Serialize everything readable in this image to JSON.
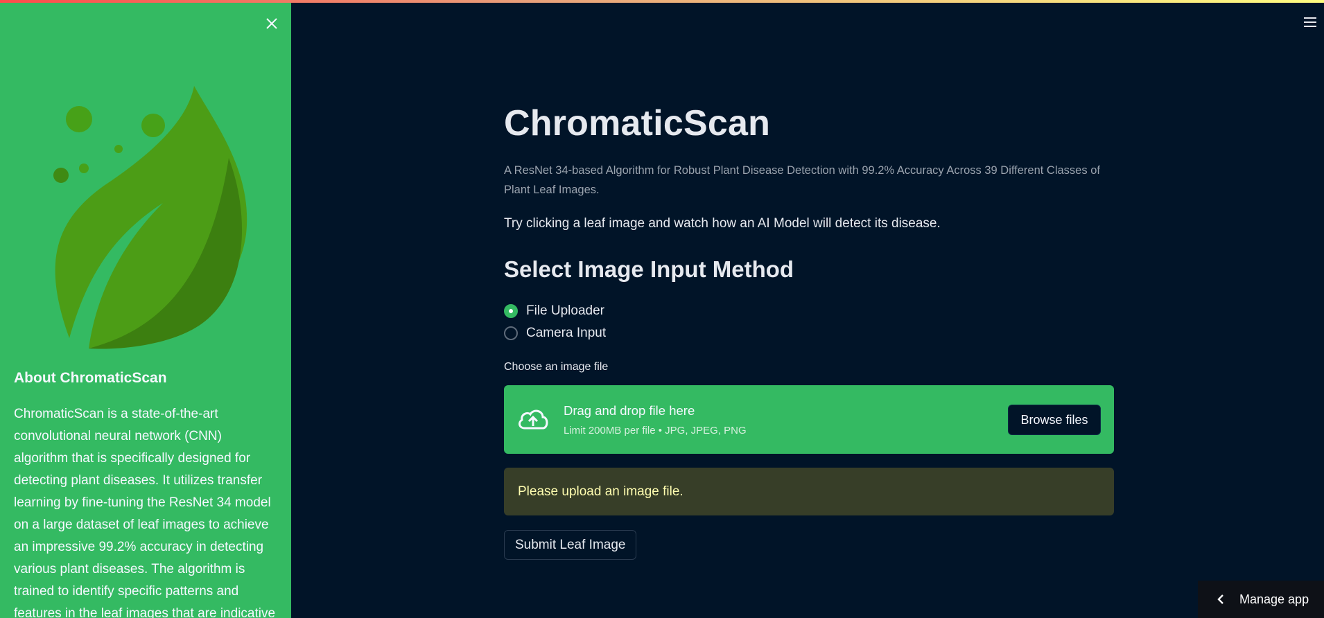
{
  "sidebar": {
    "close_icon": "close-icon",
    "logo": "leaf-logo",
    "about_title": "About ChromaticScan",
    "about_text": "ChromaticScan is a state-of-the-art convolutional neural network (CNN) algorithm that is specifically designed for detecting plant diseases. It utilizes transfer learning by fine-tuning the ResNet 34 model on a large dataset of leaf images to achieve an impressive 99.2% accuracy in detecting various plant diseases. The algorithm is trained to identify specific patterns and features in the leaf images that are indicative"
  },
  "header": {
    "menu_icon": "hamburger-icon"
  },
  "main": {
    "title": "ChromaticScan",
    "subtitle": "A ResNet 34-based Algorithm for Robust Plant Disease Detection with 99.2% Accuracy Across 39 Different Classes of Plant Leaf Images.",
    "hint": "Try clicking a leaf image and watch how an AI Model will detect its disease.",
    "section_title": "Select Image Input Method",
    "radio_options": [
      {
        "label": "File Uploader",
        "checked": true
      },
      {
        "label": "Camera Input",
        "checked": false
      }
    ],
    "uploader": {
      "label": "Choose an image file",
      "drop_title": "Drag and drop file here",
      "drop_limit": "Limit 200MB per file • JPG, JPEG, PNG",
      "browse_label": "Browse files",
      "icon": "cloud-upload-icon"
    },
    "warning": "Please upload an image file.",
    "submit_label": "Submit Leaf Image"
  },
  "footer": {
    "manage_app_label": "Manage app"
  },
  "colors": {
    "sidebar_bg": "#34ba62",
    "main_bg": "#011428",
    "warning_bg": "#373e28",
    "warning_text": "#fffdb0"
  }
}
